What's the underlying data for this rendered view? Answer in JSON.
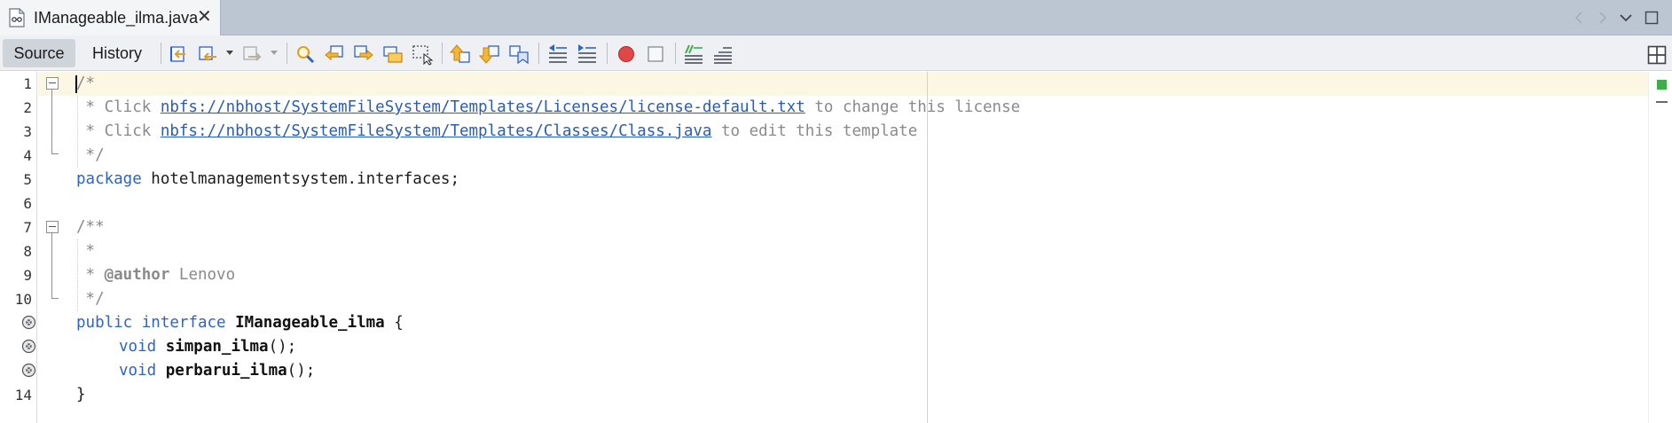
{
  "tab": {
    "label": "IManageable_ilma.java",
    "close": "✕"
  },
  "toolbar": {
    "source_label": "Source",
    "history_label": "History"
  },
  "editor": {
    "line_numbers": [
      "1",
      "2",
      "3",
      "4",
      "5",
      "6",
      "7",
      "8",
      "9",
      "10",
      "",
      "",
      "",
      "14"
    ],
    "lines": {
      "l1": "/*",
      "l2_prefix": " * Click ",
      "l2_link": "nbfs://nbhost/SystemFileSystem/Templates/Licenses/license-default.txt",
      "l2_suffix": " to change this license",
      "l3_prefix": " * Click ",
      "l3_link": "nbfs://nbhost/SystemFileSystem/Templates/Classes/Class.java",
      "l3_suffix": " to edit this template",
      "l4": " */",
      "l5_kw": "package",
      "l5_rest": " hotelmanagementsystem.interfaces;",
      "l7": "/**",
      "l8": " *",
      "l9_prefix": " * ",
      "l9_tag": "@author",
      "l9_rest": " Lenovo",
      "l10": " */",
      "l11_kw1": "public",
      "l11_kw2": "interface",
      "l11_name": "IManageable_ilma",
      "l11_brace": " {",
      "l12_kw": "void",
      "l12_name": "simpan_ilma",
      "l12_rest": "();",
      "l13_kw": "void",
      "l13_name": "perbarui_ilma",
      "l13_rest": "();",
      "l14": "}"
    }
  },
  "colors": {
    "keyword": "#2f63c6",
    "comment": "#8a8a8a",
    "link": "#2a5db0",
    "current_line": "#fcf7e3",
    "ok_status": "#3fae4a"
  },
  "icons": {
    "tab": [
      "java-file-icon",
      "close-icon"
    ],
    "strip": [
      "scroll-left-icon",
      "scroll-right-icon",
      "show-opened-documents-icon",
      "maximize-window-icon"
    ],
    "toolbar": [
      "last-edit-icon",
      "back-icon",
      "forward-icon",
      "find-selection-icon",
      "find-previous-icon",
      "find-next-icon",
      "toggle-highlight-icon",
      "toggle-rect-selection-icon",
      "previous-bookmark-icon",
      "next-bookmark-icon",
      "toggle-bookmark-icon",
      "shift-left-icon",
      "shift-right-icon",
      "start-macro-recording-icon",
      "stop-macro-recording-icon",
      "comment-icon",
      "uncomment-icon",
      "split-editor-icon"
    ],
    "gutter": [
      "fold-icon",
      "implement-marker-icon"
    ]
  }
}
